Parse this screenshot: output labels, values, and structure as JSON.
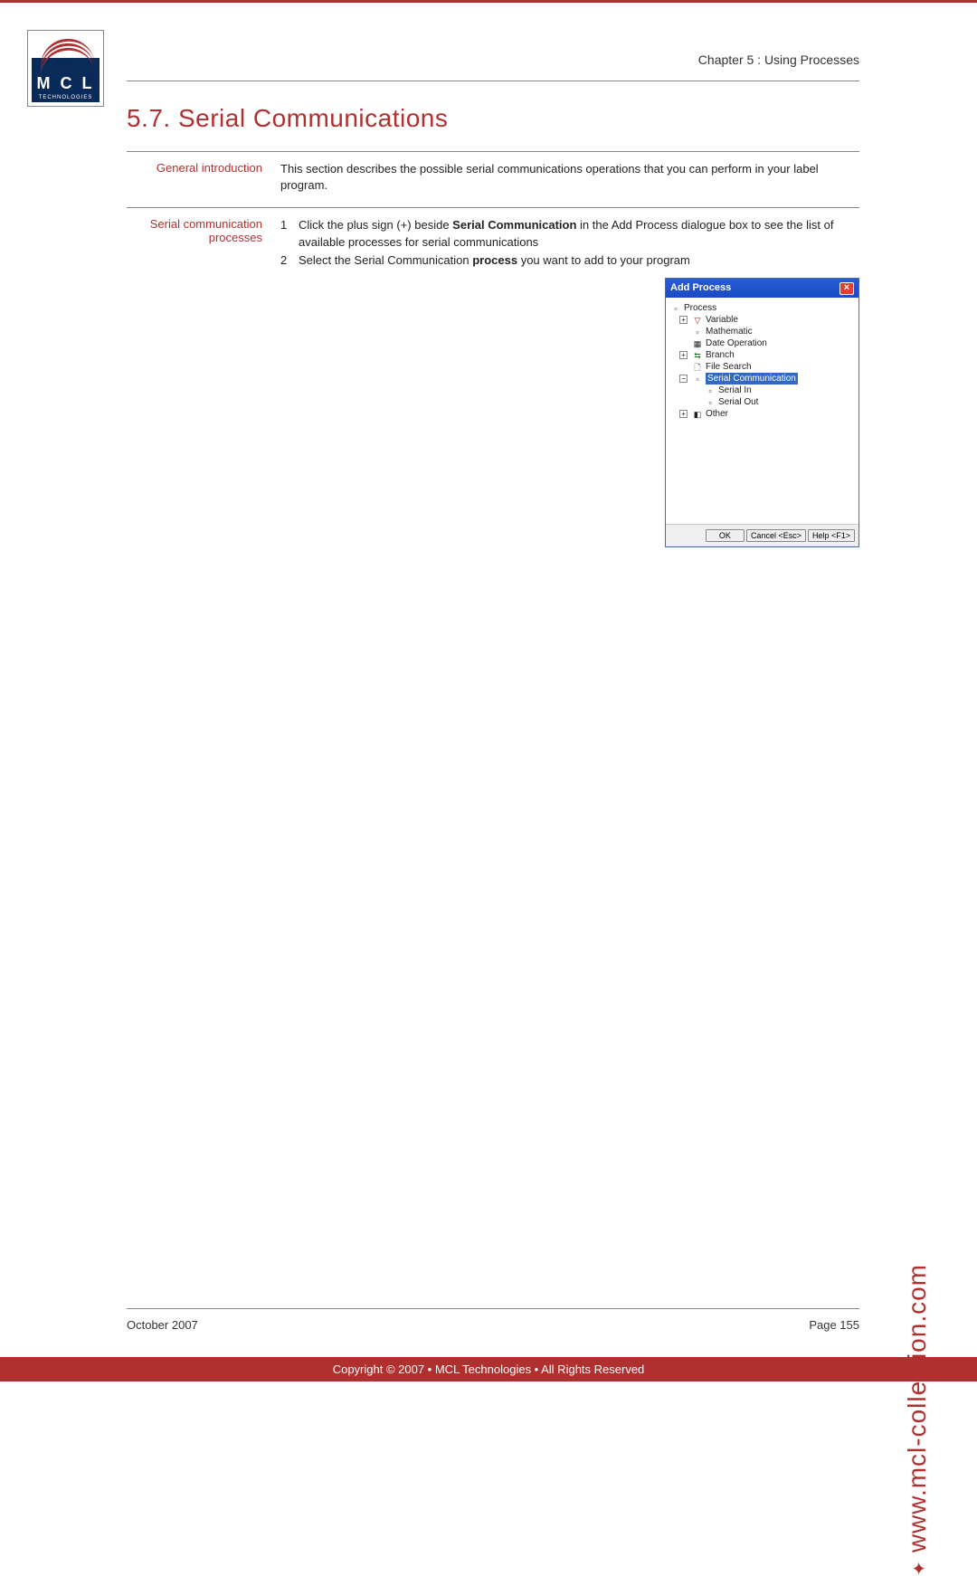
{
  "logo": {
    "main": "M C L",
    "sub": "TECHNOLOGIES"
  },
  "chapter_header": "Chapter 5 : Using Processes",
  "section_title": "5.7. Serial Communications",
  "rows": {
    "intro": {
      "label": "General introduction",
      "body": "This section describes the possible serial communications operations that you can perform in your label program."
    },
    "proc": {
      "label": "Serial communication processes",
      "steps": [
        {
          "n": "1",
          "prefix": "Click the plus sign (+) beside ",
          "bold": "Serial Communication",
          "suffix": " in the Add Process dialogue box to see the list of available processes for serial communications"
        },
        {
          "n": "2",
          "prefix": "Select the Serial Communication ",
          "bold": "process",
          "suffix": " you want to add to your program"
        }
      ]
    }
  },
  "dialog": {
    "title": "Add Process",
    "close": "×",
    "tree": {
      "root": "Process",
      "variable": "Variable",
      "mathematic": "Mathematic",
      "dateop": "Date Operation",
      "branch": "Branch",
      "filesearch": "File Search",
      "serialcomm": "Serial Communication",
      "serialin": "Serial In",
      "serialout": "Serial Out",
      "other": "Other"
    },
    "buttons": {
      "ok": "OK",
      "cancel": "Cancel <Esc>",
      "help": "Help <F1>"
    }
  },
  "side_url": "www.mcl-collection.com",
  "footer": {
    "date": "October 2007",
    "page": "Page 155",
    "copyright": "Copyright © 2007 • MCL Technologies • All Rights Reserved"
  }
}
